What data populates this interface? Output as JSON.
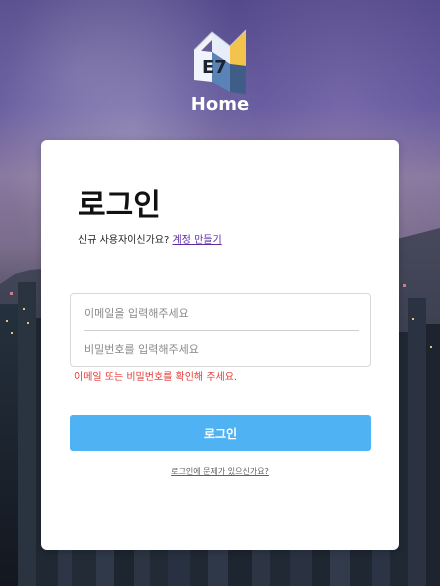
{
  "brand": {
    "logo_text": "E7",
    "name": "Home"
  },
  "login": {
    "title": "로그인",
    "signup_prompt": "신규 사용자이신가요?",
    "signup_link": "계정 만들기",
    "email_placeholder": "이메일을 입력해주세요",
    "password_placeholder": "비밀번호를 입력해주세요",
    "error_message": "이메일 또는 비밀번호를 확인해 주세요.",
    "submit_label": "로그인",
    "help_link": "로그인에 문제가 있으신가요?"
  },
  "theme": {
    "primary_button_color": "#4fb2f3",
    "error_color": "#e53935",
    "link_color": "#5b2ca8"
  }
}
